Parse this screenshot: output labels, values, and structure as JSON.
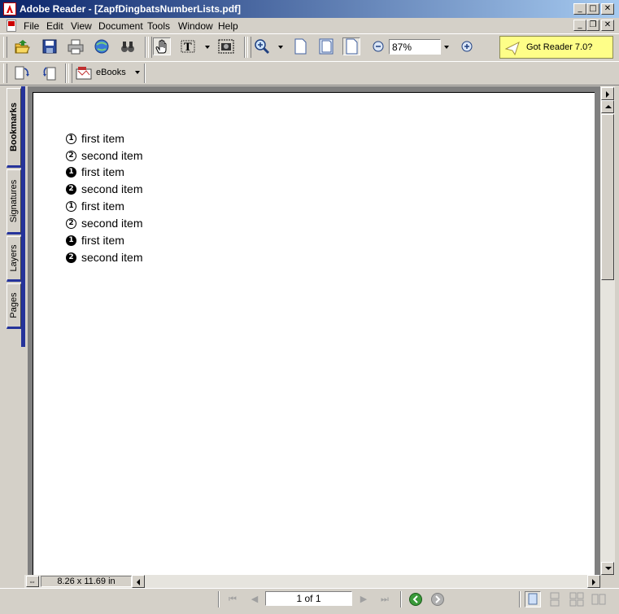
{
  "window": {
    "title": "Adobe Reader - [ZapfDingbatsNumberLists.pdf]"
  },
  "caption_buttons": {
    "minimize": "_",
    "maximize": "□",
    "close": "✕",
    "restore": "❐"
  },
  "menu": [
    "File",
    "Edit",
    "View",
    "Document",
    "Tools",
    "Window",
    "Help"
  ],
  "toolbar": {
    "zoom_value": "87%",
    "ebooks_label": "eBooks",
    "promo_label": "Got Reader 7.0?"
  },
  "side_tabs": [
    "Bookmarks",
    "Signatures",
    "Layers",
    "Pages"
  ],
  "document": {
    "items": [
      {
        "marker": "1",
        "style": "outline",
        "text": "first item"
      },
      {
        "marker": "2",
        "style": "outline",
        "text": "second item"
      },
      {
        "marker": "1",
        "style": "solid",
        "text": "first item"
      },
      {
        "marker": "2",
        "style": "solid",
        "text": "second item"
      },
      {
        "marker": "1",
        "style": "outline",
        "text": "first item"
      },
      {
        "marker": "2",
        "style": "outline",
        "text": "second item"
      },
      {
        "marker": "1",
        "style": "solid",
        "text": "first item"
      },
      {
        "marker": "2",
        "style": "solid",
        "text": "second item"
      }
    ]
  },
  "status": {
    "page_size": "8.26 x 11.69 in",
    "page_indicator": "1 of 1"
  },
  "colors": {
    "titlebar_start": "#0a246a",
    "titlebar_end": "#a6caf0",
    "promo_bg": "#fefe88",
    "tab_accent": "#25339a"
  }
}
